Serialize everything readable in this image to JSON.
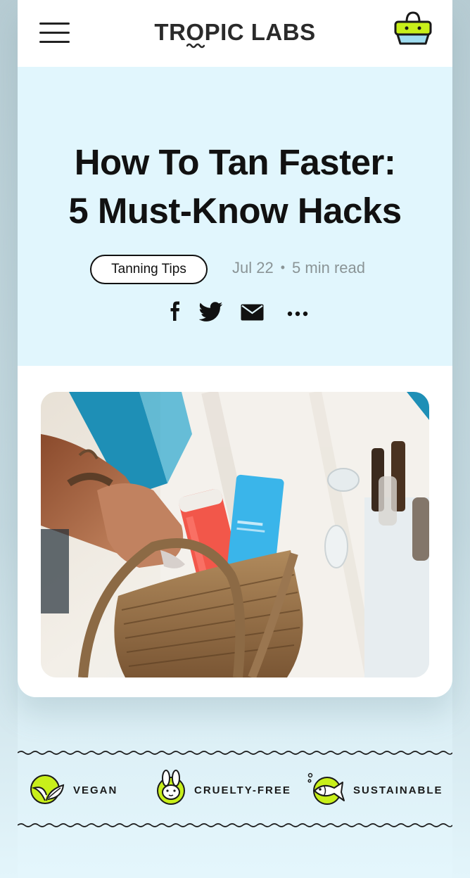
{
  "header": {
    "brand": "TROPIC LABS",
    "menu_icon": "hamburger-menu-icon",
    "cart_icon": "shopping-basket-icon"
  },
  "article": {
    "title_line1": "How To Tan Faster:",
    "title_line2": "5 Must-Know Hacks",
    "tag": "Tanning Tips",
    "date": "Jul 22",
    "separator": "•",
    "read_time": "5 min read",
    "share": [
      {
        "icon": "facebook-icon"
      },
      {
        "icon": "twitter-icon"
      },
      {
        "icon": "email-icon"
      },
      {
        "icon": "more-options-icon"
      }
    ],
    "hero_image": "hero-photo-basket-sunscreen"
  },
  "badges": [
    {
      "label": "VEGAN",
      "icon": "leaf-icon"
    },
    {
      "label": "CRUELTY-FREE",
      "icon": "bunny-icon"
    },
    {
      "label": "SUSTAINABLE",
      "icon": "fish-icon"
    }
  ],
  "colors": {
    "accent_lime": "#c8ef1a",
    "hero_bg": "#e1f6fd",
    "text_dark": "#111111",
    "meta_gray": "#8a9496"
  }
}
